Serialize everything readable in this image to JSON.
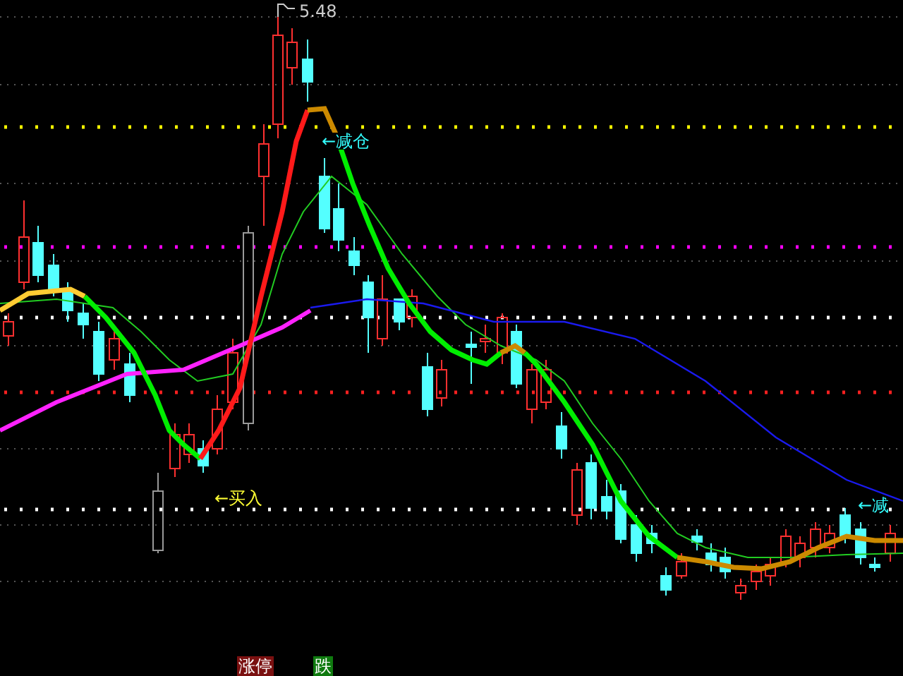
{
  "chart": {
    "high_label": "5.48",
    "signals": [
      {
        "text": "←减仓",
        "kind": "sell"
      },
      {
        "text": "←买入",
        "kind": "buy"
      },
      {
        "text": "←减",
        "kind": "sell"
      }
    ]
  },
  "legend": [
    {
      "text": "涨停",
      "color": "#7a1010"
    },
    {
      "text": "跌",
      "color": "#0f7a0f"
    }
  ]
}
